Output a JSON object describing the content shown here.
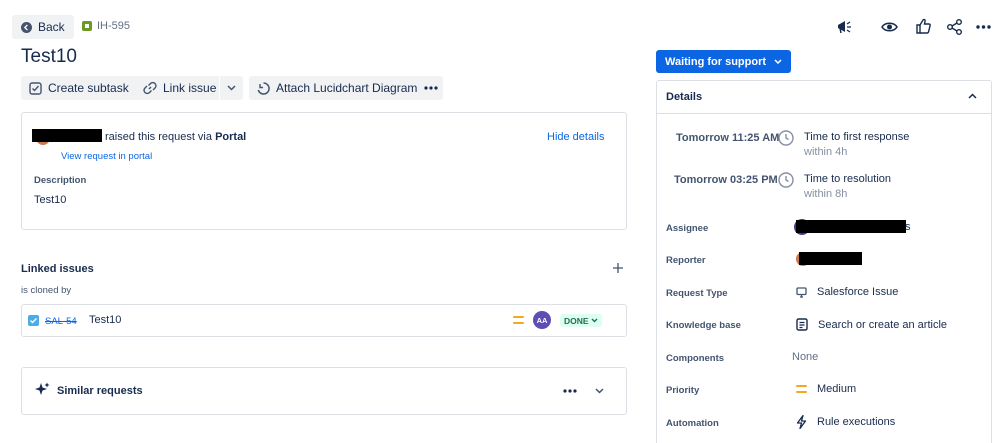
{
  "header": {
    "back_label": "Back",
    "issue_key": "IH-595",
    "title": "Test10"
  },
  "toolbar": {
    "create_subtask": "Create subtask",
    "link_issue": "Link issue",
    "attach_lucid": "Attach Lucidchart Diagram",
    "status_button": "Waiting for support"
  },
  "request": {
    "raised_text": "raised this request via",
    "portal": "Portal",
    "view_portal": "View request in portal",
    "hide_details": "Hide details",
    "description_label": "Description",
    "description_value": "Test10"
  },
  "linked": {
    "title": "Linked issues",
    "relation": "is cloned by",
    "items": [
      {
        "key": "SAL-54",
        "summary": "Test10",
        "avatar": "AA",
        "status": "DONE"
      }
    ]
  },
  "similar": {
    "title": "Similar requests"
  },
  "details": {
    "title": "Details",
    "sla": [
      {
        "time": "Tomorrow 11:25 AM",
        "label": "Time to first response",
        "sub": "within 4h"
      },
      {
        "time": "Tomorrow 03:25 PM",
        "label": "Time to resolution",
        "sub": "within 8h"
      }
    ],
    "fields": {
      "assignee_label": "Assignee",
      "assignee_suffix": "s",
      "reporter_label": "Reporter",
      "request_type_label": "Request Type",
      "request_type_value": "Salesforce Issue",
      "knowledge_label": "Knowledge base",
      "knowledge_value": "Search or create an article",
      "components_label": "Components",
      "components_value": "None",
      "priority_label": "Priority",
      "priority_value": "Medium",
      "automation_label": "Automation",
      "automation_value": "Rule executions"
    }
  },
  "colors": {
    "primary": "#0c66e4",
    "status_bg": "#0c66e4",
    "done_bg": "#dcfff1",
    "done_text": "#216e4e",
    "avatar_bg": "#5e4db2",
    "priority": "#f5a623",
    "issue_icon": "#6a9a23"
  }
}
